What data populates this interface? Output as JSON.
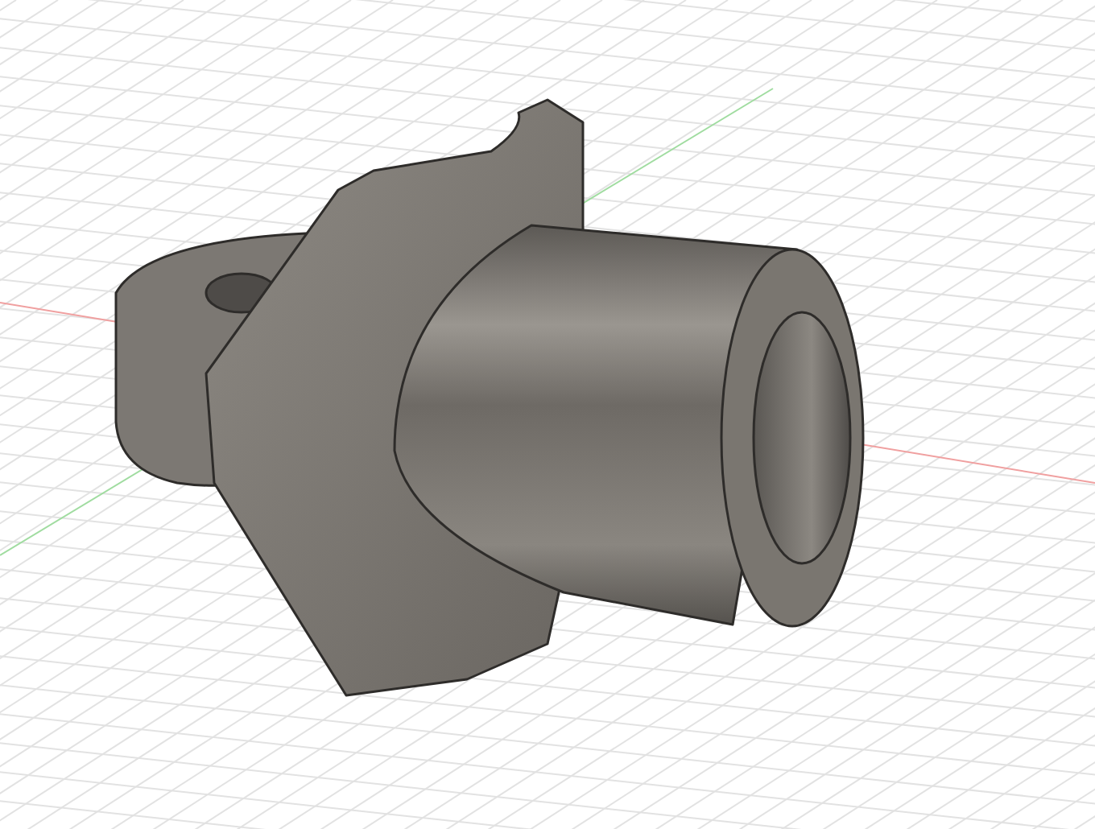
{
  "viewport": {
    "kind": "model",
    "grid": true
  }
}
